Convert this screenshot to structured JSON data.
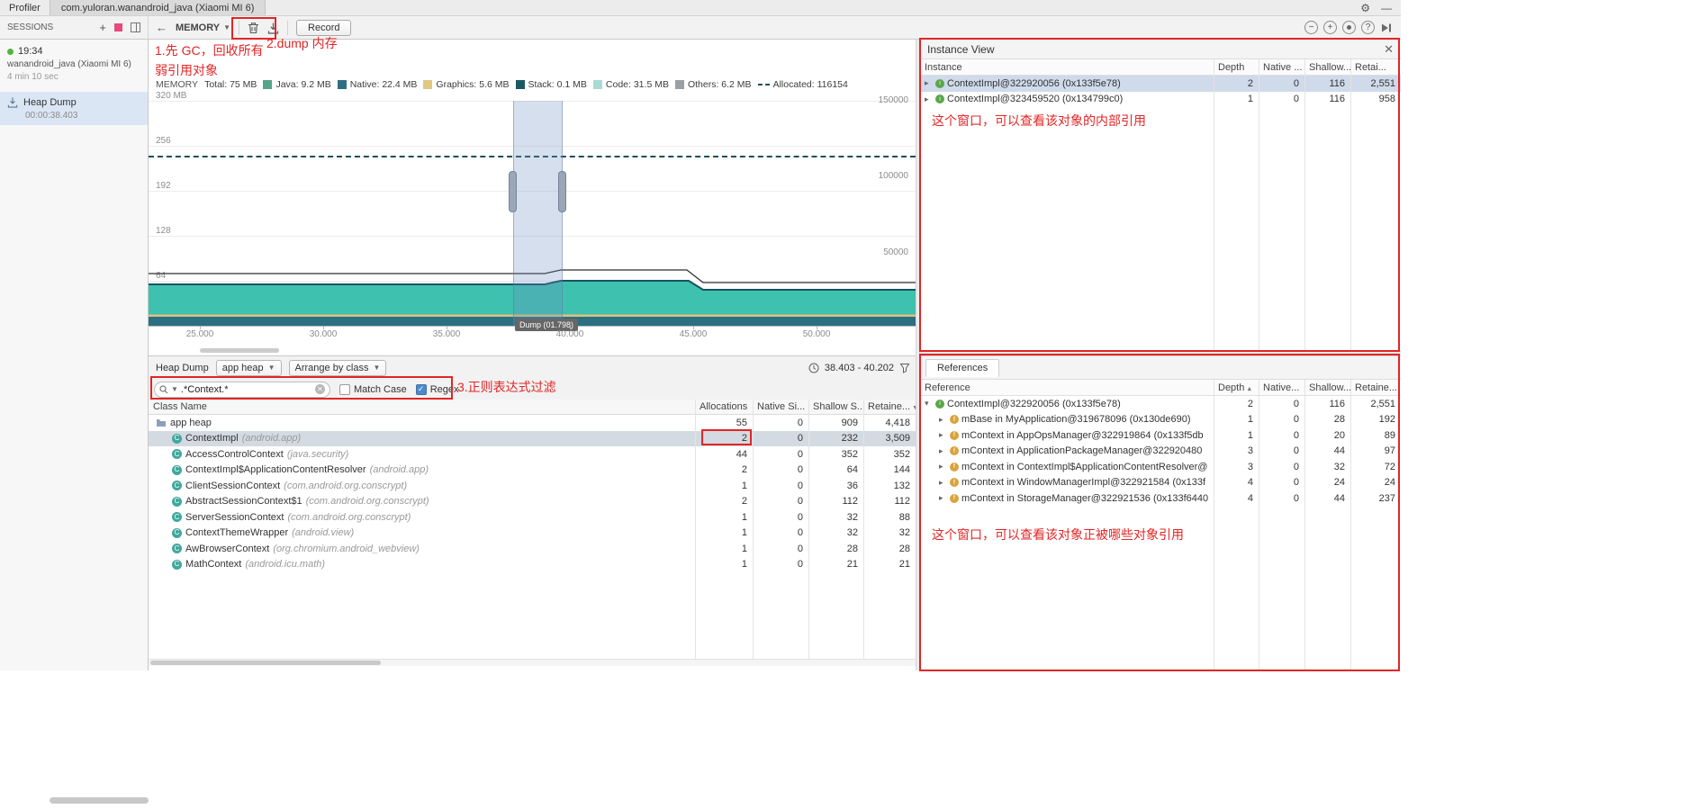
{
  "window": {
    "profiler_label": "Profiler",
    "session_tab": "com.yuloran.wanandroid_java (Xiaomi MI 6)"
  },
  "toolbar": {
    "sessions": "SESSIONS",
    "memory": "MEMORY",
    "record": "Record"
  },
  "sidebar": {
    "time": "19:34",
    "name": "wanandroid_java (Xiaomi MI 6)",
    "duration": "4 min 10 sec",
    "artifact": "Heap Dump",
    "artifact_time": "00:00:38.403"
  },
  "annotations": {
    "step1a": "1.先 GC，回收所有",
    "step1b": "弱引用对象",
    "step2": "2.dump 内存",
    "step3": "3.正则表达式过滤",
    "instance_note": "这个窗口，可以查看该对象的内部引用",
    "reference_note": "这个窗口，可以查看该对象正被哪些对象引用"
  },
  "colors": {
    "annotation_red": "#e22525",
    "selection_blue": "#6c8cbe",
    "chart_teal": "#3fc1b0",
    "chart_dark_band": "#2c6f83"
  },
  "chart": {
    "label": "MEMORY",
    "total": "Total: 75 MB",
    "legend": [
      {
        "name": "Java",
        "value": "9.2 MB",
        "color": "#55a58a",
        "type": "box"
      },
      {
        "name": "Native",
        "value": "22.4 MB",
        "color": "#2d6f80",
        "type": "box"
      },
      {
        "name": "Graphics",
        "value": "5.6 MB",
        "color": "#e0c882",
        "type": "box"
      },
      {
        "name": "Stack",
        "value": "0.1 MB",
        "color": "#1b5a62",
        "type": "box"
      },
      {
        "name": "Code",
        "value": "31.5 MB",
        "color": "#aadbd3",
        "type": "box"
      },
      {
        "name": "Others",
        "value": "6.2 MB",
        "color": "#9aa0a6",
        "type": "box"
      },
      {
        "name": "Allocated",
        "value": "116154",
        "color": "#1d4f58",
        "type": "dash"
      }
    ],
    "y_ticks": [
      "320 MB",
      "256",
      "192",
      "128",
      "64"
    ],
    "right_ticks": [
      "150000",
      "100000",
      "50000"
    ],
    "x_ticks": [
      "25.000",
      "30.000",
      "35.000",
      "40.000",
      "45.000",
      "50.000"
    ],
    "dump_label": "Dump (01.798)"
  },
  "heap": {
    "title": "Heap Dump",
    "heap_select": "app heap",
    "arrange_select": "Arrange by class",
    "range": "38.403 - 40.202",
    "search": ".*Context.*",
    "match_case": "Match Case",
    "regex": "Regex",
    "columns": [
      "Class Name",
      "Allocations",
      "Native Si...",
      "Shallow S...",
      "Retaine..."
    ],
    "rows": [
      {
        "type": "heap",
        "name": "app heap",
        "pkg": "",
        "alloc": "55",
        "native": "0",
        "shallow": "909",
        "retained": "4,418"
      },
      {
        "type": "class",
        "name": "ContextImpl",
        "pkg": "(android.app)",
        "alloc": "2",
        "native": "0",
        "shallow": "232",
        "retained": "3,509",
        "selected": true
      },
      {
        "type": "class",
        "name": "AccessControlContext",
        "pkg": "(java.security)",
        "alloc": "44",
        "native": "0",
        "shallow": "352",
        "retained": "352"
      },
      {
        "type": "class",
        "name": "ContextImpl$ApplicationContentResolver",
        "pkg": "(android.app)",
        "alloc": "2",
        "native": "0",
        "shallow": "64",
        "retained": "144"
      },
      {
        "type": "class",
        "name": "ClientSessionContext",
        "pkg": "(com.android.org.conscrypt)",
        "alloc": "1",
        "native": "0",
        "shallow": "36",
        "retained": "132"
      },
      {
        "type": "class",
        "name": "AbstractSessionContext$1",
        "pkg": "(com.android.org.conscrypt)",
        "alloc": "2",
        "native": "0",
        "shallow": "112",
        "retained": "112"
      },
      {
        "type": "class",
        "name": "ServerSessionContext",
        "pkg": "(com.android.org.conscrypt)",
        "alloc": "1",
        "native": "0",
        "shallow": "32",
        "retained": "88"
      },
      {
        "type": "class",
        "name": "ContextThemeWrapper",
        "pkg": "(android.view)",
        "alloc": "1",
        "native": "0",
        "shallow": "32",
        "retained": "32"
      },
      {
        "type": "class",
        "name": "AwBrowserContext",
        "pkg": "(org.chromium.android_webview)",
        "alloc": "1",
        "native": "0",
        "shallow": "28",
        "retained": "28"
      },
      {
        "type": "class",
        "name": "MathContext",
        "pkg": "(android.icu.math)",
        "alloc": "1",
        "native": "0",
        "shallow": "21",
        "retained": "21"
      }
    ]
  },
  "instance_view": {
    "title": "Instance View",
    "columns": [
      "Instance",
      "Depth",
      "Native ...",
      "Shallow...",
      "Retai..."
    ],
    "rows": [
      {
        "label": "ContextImpl@322920056 (0x133f5e78)",
        "depth": "2",
        "native": "0",
        "shallow": "116",
        "retained": "2,551",
        "selected": true
      },
      {
        "label": "ContextImpl@323459520 (0x134799c0)",
        "depth": "1",
        "native": "0",
        "shallow": "116",
        "retained": "958"
      }
    ]
  },
  "references": {
    "title": "References",
    "columns": [
      "Reference",
      "Depth",
      "Native...",
      "Shallow...",
      "Retaine..."
    ],
    "rows": [
      {
        "label": "ContextImpl@322920056 (0x133f5e78)",
        "depth": "2",
        "native": "0",
        "shallow": "116",
        "retained": "2,551",
        "icon": "instance",
        "level": 0,
        "expanded": true
      },
      {
        "label": "mBase in MyApplication@319678096 (0x130de690)",
        "depth": "1",
        "native": "0",
        "shallow": "28",
        "retained": "192",
        "icon": "field",
        "level": 1
      },
      {
        "label": "mContext in AppOpsManager@322919864 (0x133f5db",
        "depth": "1",
        "native": "0",
        "shallow": "20",
        "retained": "89",
        "icon": "field",
        "level": 1
      },
      {
        "label": "mContext in ApplicationPackageManager@322920480",
        "depth": "3",
        "native": "0",
        "shallow": "44",
        "retained": "97",
        "icon": "field",
        "level": 1
      },
      {
        "label": "mContext in ContextImpl$ApplicationContentResolver@",
        "depth": "3",
        "native": "0",
        "shallow": "32",
        "retained": "72",
        "icon": "field",
        "level": 1
      },
      {
        "label": "mContext in WindowManagerImpl@322921584 (0x133f",
        "depth": "4",
        "native": "0",
        "shallow": "24",
        "retained": "24",
        "icon": "field",
        "level": 1
      },
      {
        "label": "mContext in StorageManager@322921536 (0x133f6440",
        "depth": "4",
        "native": "0",
        "shallow": "44",
        "retained": "237",
        "icon": "field",
        "level": 1
      }
    ]
  }
}
